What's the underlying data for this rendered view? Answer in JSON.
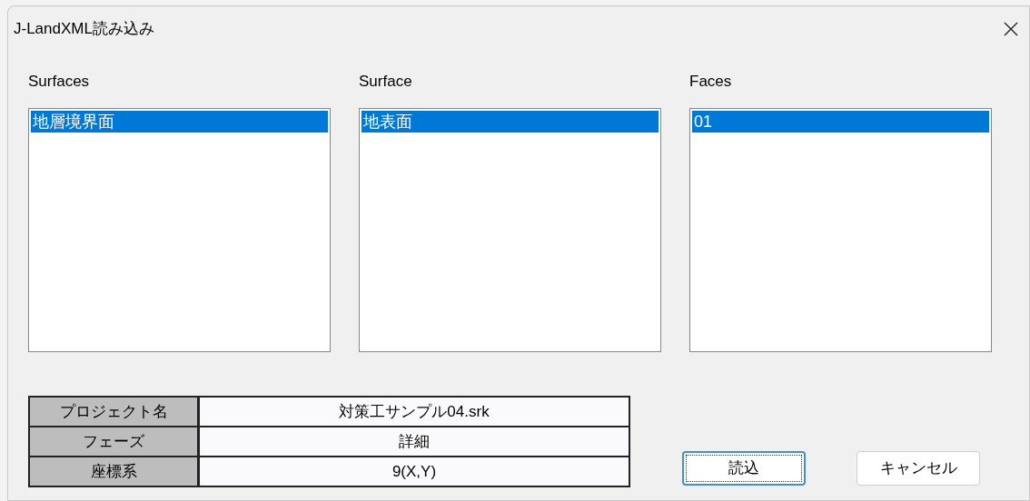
{
  "window": {
    "title": "J-LandXML読み込み"
  },
  "lists": [
    {
      "label": "Surfaces",
      "items": [
        {
          "text": "地層境界面",
          "selected": true
        }
      ]
    },
    {
      "label": "Surface",
      "items": [
        {
          "text": "地表面",
          "selected": true
        }
      ]
    },
    {
      "label": "Faces",
      "items": [
        {
          "text": "01",
          "selected": true
        }
      ]
    }
  ],
  "properties": [
    {
      "name": "プロジェクト名",
      "value": "対策工サンプル04.srk"
    },
    {
      "name": "フェーズ",
      "value": "詳細"
    },
    {
      "name": "座標系",
      "value": "9(X,Y)"
    }
  ],
  "buttons": [
    {
      "label": "読込",
      "focused": true
    },
    {
      "label": "キャンセル",
      "focused": false
    }
  ]
}
